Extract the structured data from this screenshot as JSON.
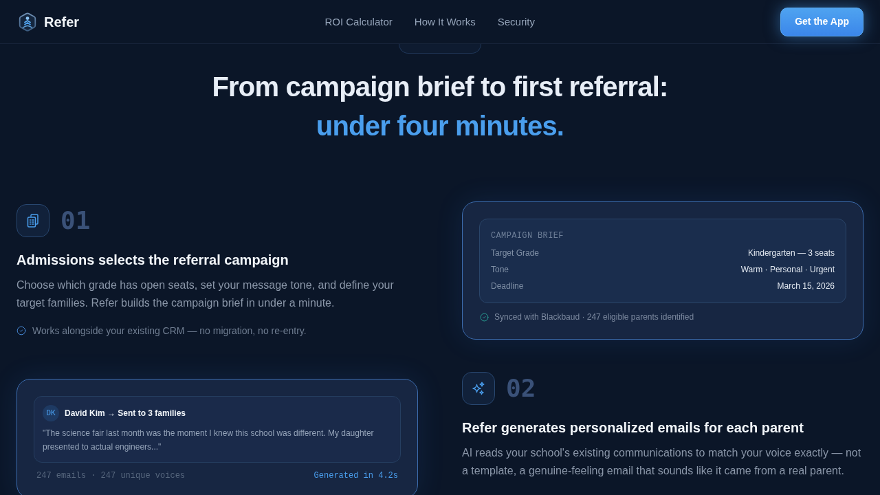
{
  "nav": {
    "brand": "Refer",
    "links": [
      "ROI Calculator",
      "How It Works",
      "Security"
    ],
    "cta": "Get the App"
  },
  "hero": {
    "title": "From campaign brief to first referral:",
    "highlight": "under four minutes."
  },
  "steps": [
    {
      "number": "01",
      "title": "Admissions selects the referral campaign",
      "body": "Choose which grade has open seats, set your message tone, and define your target families. Refer builds the campaign brief in under a minute.",
      "note": "Works alongside your existing CRM — no migration, no re-entry.",
      "card": {
        "kind": "brief",
        "heading": "CAMPAIGN BRIEF",
        "rows": [
          {
            "label": "Target Grade",
            "value": "Kindergarten — 3 seats"
          },
          {
            "label": "Tone",
            "value": "Warm · Personal · Urgent"
          },
          {
            "label": "Deadline",
            "value": "March 15, 2026"
          }
        ],
        "footer": "Synced with Blackbaud · 247 eligible parents identified"
      }
    },
    {
      "number": "02",
      "title": "Refer generates personalized emails for each parent",
      "body": "AI reads your school's existing communications to match your voice exactly — not a template, a genuine-feeling email that sounds like it came from a real parent.",
      "card": {
        "kind": "email",
        "avatar": "DK",
        "header": "David Kim → Sent to 3 families",
        "quote": "\"The science fair last month was the moment I knew this school was different. My daughter presented to actual engineers...\"",
        "stats": "247 emails · 247 unique voices",
        "timing": "Generated in 4.2s"
      }
    }
  ]
}
